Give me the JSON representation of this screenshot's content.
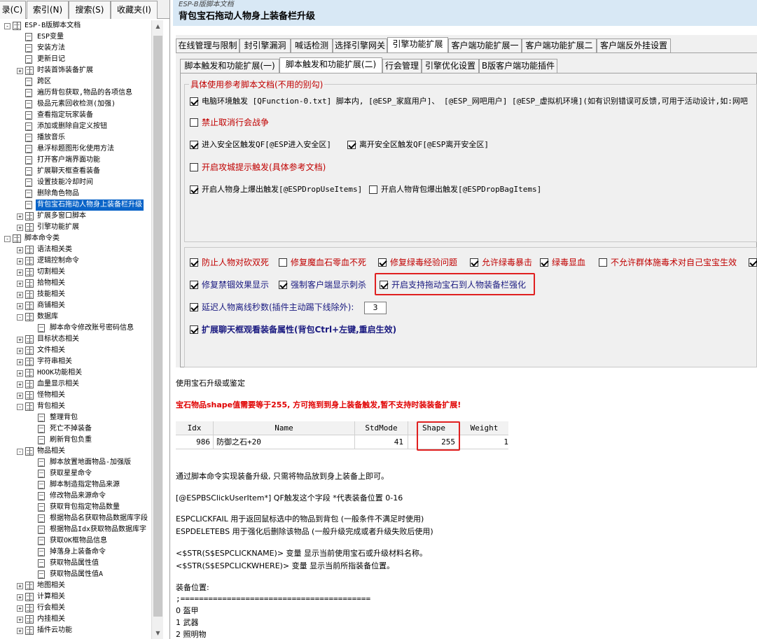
{
  "left_tabs": [
    "录(C)",
    "索引(N)",
    "搜索(S)",
    "收藏夹(I)"
  ],
  "tree": [
    {
      "label": "ESP-B版脚本文档",
      "level": 0,
      "expander": "-",
      "icon": "book"
    },
    {
      "label": "ESP变量",
      "level": 1,
      "expander": "",
      "icon": "page"
    },
    {
      "label": "安装方法",
      "level": 1,
      "expander": "",
      "icon": "page"
    },
    {
      "label": "更新日记",
      "level": 1,
      "expander": "",
      "icon": "page"
    },
    {
      "label": "时装首饰装备扩展",
      "level": 1,
      "expander": "+",
      "icon": "book"
    },
    {
      "label": "跨区",
      "level": 1,
      "expander": "",
      "icon": "page"
    },
    {
      "label": "遍历背包获取,物品的各项信息",
      "level": 1,
      "expander": "",
      "icon": "page"
    },
    {
      "label": "极品元素回收检测(加强)",
      "level": 1,
      "expander": "",
      "icon": "page"
    },
    {
      "label": "查看指定玩家装备",
      "level": 1,
      "expander": "",
      "icon": "page"
    },
    {
      "label": "添加或删除自定义按钮",
      "level": 1,
      "expander": "",
      "icon": "page"
    },
    {
      "label": "播放音乐",
      "level": 1,
      "expander": "",
      "icon": "page"
    },
    {
      "label": "悬浮标题图形化使用方法",
      "level": 1,
      "expander": "",
      "icon": "page"
    },
    {
      "label": "打开客户端界面功能",
      "level": 1,
      "expander": "",
      "icon": "page"
    },
    {
      "label": "扩展聊天框查看装备",
      "level": 1,
      "expander": "",
      "icon": "page"
    },
    {
      "label": "设置技能冷却时间",
      "level": 1,
      "expander": "",
      "icon": "page"
    },
    {
      "label": "删除角色物品",
      "level": 1,
      "expander": "",
      "icon": "page"
    },
    {
      "label": "背包宝石拖动人物身上装备栏升级",
      "level": 1,
      "expander": "",
      "icon": "page",
      "selected": true
    },
    {
      "label": "扩展多窗口脚本",
      "level": 1,
      "expander": "+",
      "icon": "book"
    },
    {
      "label": "引擎功能扩展",
      "level": 1,
      "expander": "+",
      "icon": "book"
    },
    {
      "label": "脚本命令类",
      "level": 0,
      "expander": "-",
      "icon": "book"
    },
    {
      "label": "语法相关类",
      "level": 1,
      "expander": "+",
      "icon": "book"
    },
    {
      "label": "逻辑控制命令",
      "level": 1,
      "expander": "+",
      "icon": "book"
    },
    {
      "label": "切割相关",
      "level": 1,
      "expander": "+",
      "icon": "book"
    },
    {
      "label": "拾物相关",
      "level": 1,
      "expander": "+",
      "icon": "book"
    },
    {
      "label": "技能相关",
      "level": 1,
      "expander": "+",
      "icon": "book"
    },
    {
      "label": "商铺相关",
      "level": 1,
      "expander": "+",
      "icon": "book"
    },
    {
      "label": "数据库",
      "level": 1,
      "expander": "-",
      "icon": "book"
    },
    {
      "label": "脚本命令修改账号密码信息",
      "level": 2,
      "expander": "",
      "icon": "page"
    },
    {
      "label": "目标状态相关",
      "level": 1,
      "expander": "+",
      "icon": "book"
    },
    {
      "label": "文件相关",
      "level": 1,
      "expander": "+",
      "icon": "book"
    },
    {
      "label": "字符串相关",
      "level": 1,
      "expander": "+",
      "icon": "book"
    },
    {
      "label": "HOOK功能相关",
      "level": 1,
      "expander": "+",
      "icon": "book"
    },
    {
      "label": "血量显示相关",
      "level": 1,
      "expander": "+",
      "icon": "book"
    },
    {
      "label": "怪物相关",
      "level": 1,
      "expander": "+",
      "icon": "book"
    },
    {
      "label": "背包相关",
      "level": 1,
      "expander": "-",
      "icon": "book"
    },
    {
      "label": "整理背包",
      "level": 2,
      "expander": "",
      "icon": "page"
    },
    {
      "label": "死亡不掉装备",
      "level": 2,
      "expander": "",
      "icon": "page"
    },
    {
      "label": "刷新背包负重",
      "level": 2,
      "expander": "",
      "icon": "page"
    },
    {
      "label": "物品相关",
      "level": 1,
      "expander": "-",
      "icon": "book"
    },
    {
      "label": "脚本放置地面物品-加强版",
      "level": 2,
      "expander": "",
      "icon": "page"
    },
    {
      "label": "获取星星命令",
      "level": 2,
      "expander": "",
      "icon": "page"
    },
    {
      "label": "脚本制造指定物品来源",
      "level": 2,
      "expander": "",
      "icon": "page"
    },
    {
      "label": "修改物品来源命令",
      "level": 2,
      "expander": "",
      "icon": "page"
    },
    {
      "label": "获取背包指定物品数量",
      "level": 2,
      "expander": "",
      "icon": "page"
    },
    {
      "label": "根据物品名获取物品数据库字段",
      "level": 2,
      "expander": "",
      "icon": "page"
    },
    {
      "label": "根据物品Idx获取物品数据库字",
      "level": 2,
      "expander": "",
      "icon": "page"
    },
    {
      "label": "获取OK框物品信息",
      "level": 2,
      "expander": "",
      "icon": "page"
    },
    {
      "label": "掉落身上装备命令",
      "level": 2,
      "expander": "",
      "icon": "page"
    },
    {
      "label": "获取物品属性值",
      "level": 2,
      "expander": "",
      "icon": "page"
    },
    {
      "label": "获取物品属性值A",
      "level": 2,
      "expander": "",
      "icon": "page"
    },
    {
      "label": "地图相关",
      "level": 1,
      "expander": "+",
      "icon": "book"
    },
    {
      "label": "计算相关",
      "level": 1,
      "expander": "+",
      "icon": "book"
    },
    {
      "label": "行会相关",
      "level": 1,
      "expander": "+",
      "icon": "book"
    },
    {
      "label": "内挂相关",
      "level": 1,
      "expander": "+",
      "icon": "book"
    },
    {
      "label": "插件云功能",
      "level": 1,
      "expander": "+",
      "icon": "book"
    }
  ],
  "header": {
    "subtitle": "ESP-B版脚本文档",
    "title": "背包宝石拖动人物身上装备栏升级"
  },
  "tabs1": [
    "在线管理与限制",
    "封引擎漏洞",
    "喊话检测",
    "选择引擎网关",
    "引擎功能扩展",
    "客户端功能扩展一",
    "客户端功能扩展二",
    "客户端反外挂设置"
  ],
  "tabs2": [
    "脚本触发和功能扩展(一)",
    "脚本触发和功能扩展(二)",
    "行会管理",
    "引擎优化设置",
    "B版客户端功能插件"
  ],
  "group_title": "具体使用参考脚本文档(不用的别勾)",
  "group_items": {
    "env": "电脑环境触发 [QFunction-0.txt] 脚本内, [@ESP_家庭用户]、 [@ESP_网吧用户] [@ESP_虚拟机环境](如有识别错误可反馈,可用于活动设计,如:网吧",
    "ban_guild_war": "禁止取消行会战争",
    "enter_safe": "进入安全区触发QF[@ESP进入安全区]",
    "leave_safe": "离开安全区触发QF[@ESP离开安全区]",
    "siege_tip": "开启攻城提示触发(具体参考文档)",
    "drop_use": "开启人物身上爆出触发[@ESPDropUseItems]",
    "drop_bag": "开启人物背包爆出触发[@ESPDropBagItems]"
  },
  "opts": {
    "anti_double": "防止人物对砍双死",
    "fix_mp_stone": "修复魔血石零血不死",
    "fix_poison_exp": "修复绿毒经验问题",
    "allow_poison_crit": "允许绿毒暴击",
    "poison_blood": "绿毒显血",
    "no_group_poison": "不允许群体施毒术对自己宝宝生效",
    "fix_bind": "修复禁锢效果显示",
    "force_stab": "强制客户端显示刺杀",
    "drag_gem": "开启支持拖动宝石到人物装备栏强化",
    "delay_offline": "延迟人物离线秒数(插件主动踢下线除外):",
    "delay_value": "3",
    "chat_view": "扩展聊天框观看装备属性(背包Ctrl+左键,重启生效)"
  },
  "doc": {
    "usage": "使用宝石升级或鉴定",
    "warning": "宝石物品shape值需要等于255, 方可拖到到身上装备触发,暂不支持时装装备扩展!",
    "table_headers": [
      "Idx",
      "Name",
      "StdMode",
      "Shape",
      "Weight"
    ],
    "table_row": [
      "986",
      "防御之石+20",
      "41",
      "255",
      "1"
    ],
    "note1": "通过脚本命令实现装备升级, 只需将物品放到身上装备上即可。",
    "note2": "[@ESPBSClickUserItem*]    QF触发这个字段 *代表装备位置 0-16",
    "fail": "ESPCLICKFAIL     用于返回鼠标选中的物品到背包 (一般条件不满足时使用)",
    "delete": "ESPDELETEBS     用于强化后删除该物品 (一般升级完成或者升级失败后使用)",
    "var1": "<$STR(S$ESPCLICKNAME)>      变量 显示当前使用宝石或升级材料名称。",
    "var2": "<$STR(S$ESPCLICKWHERE)>   变量  显示当前所指装备位置。",
    "pos_title": "装备位置:",
    "separator": ";=========================================",
    "pos0": "0 盔甲",
    "pos1": "1 武器",
    "pos2": "2 照明物"
  }
}
